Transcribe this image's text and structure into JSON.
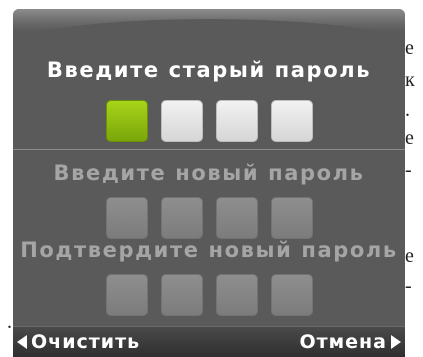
{
  "background": {
    "right_edge_fragments": [
      "е",
      "к",
      ".",
      "е",
      "-",
      "е",
      "-"
    ],
    "left_edge_fragments": [
      "."
    ]
  },
  "dialog": {
    "old_password": {
      "heading": "Введите старый пароль",
      "digits": [
        "filled",
        "empty",
        "empty",
        "empty"
      ]
    },
    "new_password": {
      "heading": "Введите новый пароль",
      "digits": [
        "inactive",
        "inactive",
        "inactive",
        "inactive"
      ]
    },
    "confirm_password": {
      "heading": "Подтвердите новый пароль",
      "digits": [
        "inactive",
        "inactive",
        "inactive",
        "inactive"
      ]
    },
    "colors": {
      "screen": "#5a5a5a",
      "filled_digit": "#8cbc10",
      "empty_digit": "#e6e6e6",
      "inactive_digit": "#858585",
      "active_heading": "#ffffff",
      "inactive_heading": "#a5a5a5"
    }
  },
  "softkeys": {
    "left_label": "Очистить",
    "right_label": "Отмена",
    "left_icon": "triangle-left-icon",
    "right_icon": "triangle-right-icon"
  }
}
